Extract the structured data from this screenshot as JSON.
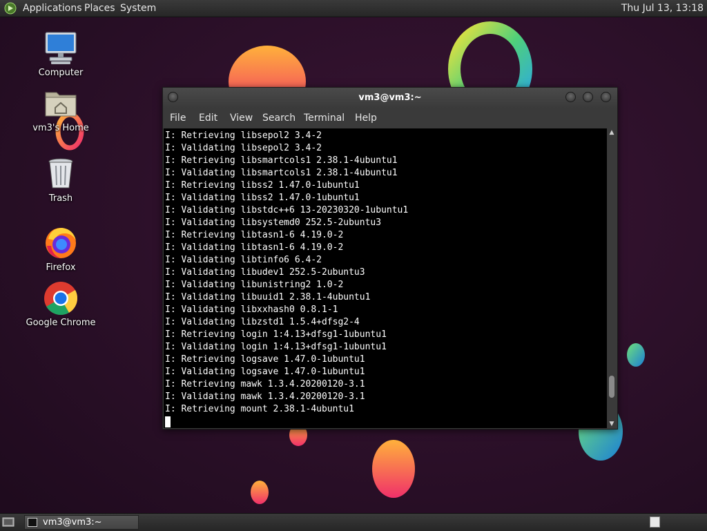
{
  "top_panel": {
    "menus": [
      "Applications",
      "Places",
      "System"
    ],
    "clock": "Thu Jul 13, 13:18"
  },
  "desktop_icons": [
    {
      "label": "Computer",
      "icon": "computer-icon"
    },
    {
      "label": "vm3's Home",
      "icon": "home-folder-icon"
    },
    {
      "label": "Trash",
      "icon": "trash-icon"
    },
    {
      "label": "Firefox",
      "icon": "firefox-icon"
    },
    {
      "label": "Google Chrome",
      "icon": "chrome-icon"
    }
  ],
  "terminal": {
    "title": "vm3@vm3:~",
    "menus": [
      "File",
      "Edit",
      "View",
      "Search",
      "Terminal",
      "Help"
    ],
    "lines": [
      "I: Retrieving libsepol2 3.4-2",
      "I: Validating libsepol2 3.4-2",
      "I: Retrieving libsmartcols1 2.38.1-4ubuntu1",
      "I: Validating libsmartcols1 2.38.1-4ubuntu1",
      "I: Retrieving libss2 1.47.0-1ubuntu1",
      "I: Validating libss2 1.47.0-1ubuntu1",
      "I: Validating libstdc++6 13-20230320-1ubuntu1",
      "I: Validating libsystemd0 252.5-2ubuntu3",
      "I: Retrieving libtasn1-6 4.19.0-2",
      "I: Validating libtasn1-6 4.19.0-2",
      "I: Validating libtinfo6 6.4-2",
      "I: Validating libudev1 252.5-2ubuntu3",
      "I: Validating libunistring2 1.0-2",
      "I: Validating libuuid1 2.38.1-4ubuntu1",
      "I: Validating libxxhash0 0.8.1-1",
      "I: Validating libzstd1 1.5.4+dfsg2-4",
      "I: Retrieving login 1:4.13+dfsg1-1ubuntu1",
      "I: Validating login 1:4.13+dfsg1-1ubuntu1",
      "I: Retrieving logsave 1.47.0-1ubuntu1",
      "I: Validating logsave 1.47.0-1ubuntu1",
      "I: Retrieving mawk 1.3.4.20200120-3.1",
      "I: Validating mawk 1.3.4.20200120-3.1",
      "I: Retrieving mount 2.38.1-4ubuntu1"
    ],
    "scroll_position_fraction": 0.92,
    "scroll_thumb_fraction": 0.08
  },
  "taskbar": {
    "task_label": "vm3@vm3:~"
  },
  "colors": {
    "wallpaper_bg": "#2a1028",
    "panel": "#2f2f2f",
    "terminal_bg": "#000000",
    "terminal_fg": "#ffffff"
  }
}
